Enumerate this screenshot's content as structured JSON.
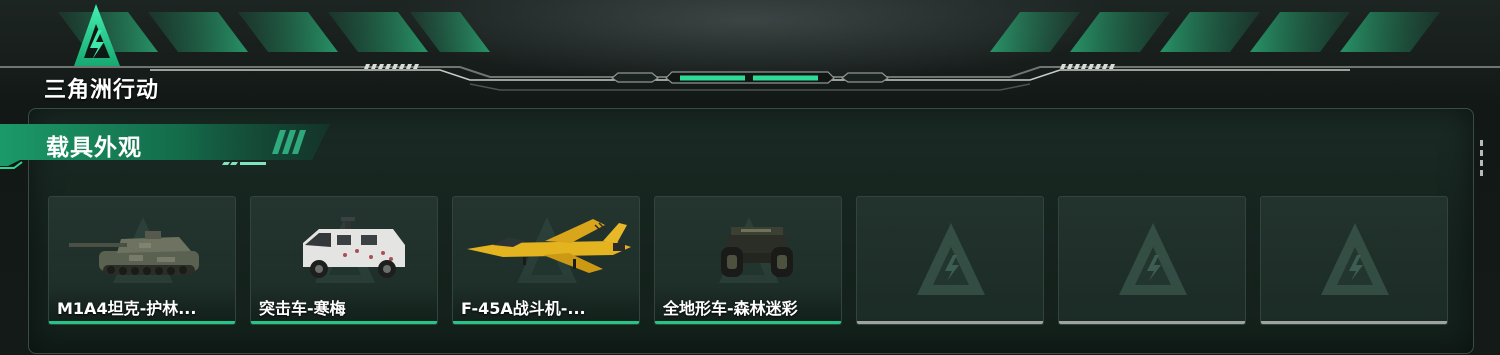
{
  "header": {
    "logo_text": "三角洲行动"
  },
  "section": {
    "title": "载具外观"
  },
  "cards": [
    {
      "label": "M1A4坦克-护林...",
      "icon": "tank-icon",
      "filled": true
    },
    {
      "label": "突击车-寒梅",
      "icon": "armored-car-icon",
      "filled": true
    },
    {
      "label": "F-45A战斗机-...",
      "icon": "fighter-jet-icon",
      "filled": true
    },
    {
      "label": "全地形车-森林迷彩",
      "icon": "atv-icon",
      "filled": true
    },
    {
      "label": "",
      "icon": "delta-watermark-icon",
      "filled": false
    },
    {
      "label": "",
      "icon": "delta-watermark-icon",
      "filled": false
    },
    {
      "label": "",
      "icon": "delta-watermark-icon",
      "filled": false
    }
  ],
  "colors": {
    "accent": "#27c488",
    "empty_bar": "#9da3a1",
    "panel_border": "#3c4a45"
  }
}
